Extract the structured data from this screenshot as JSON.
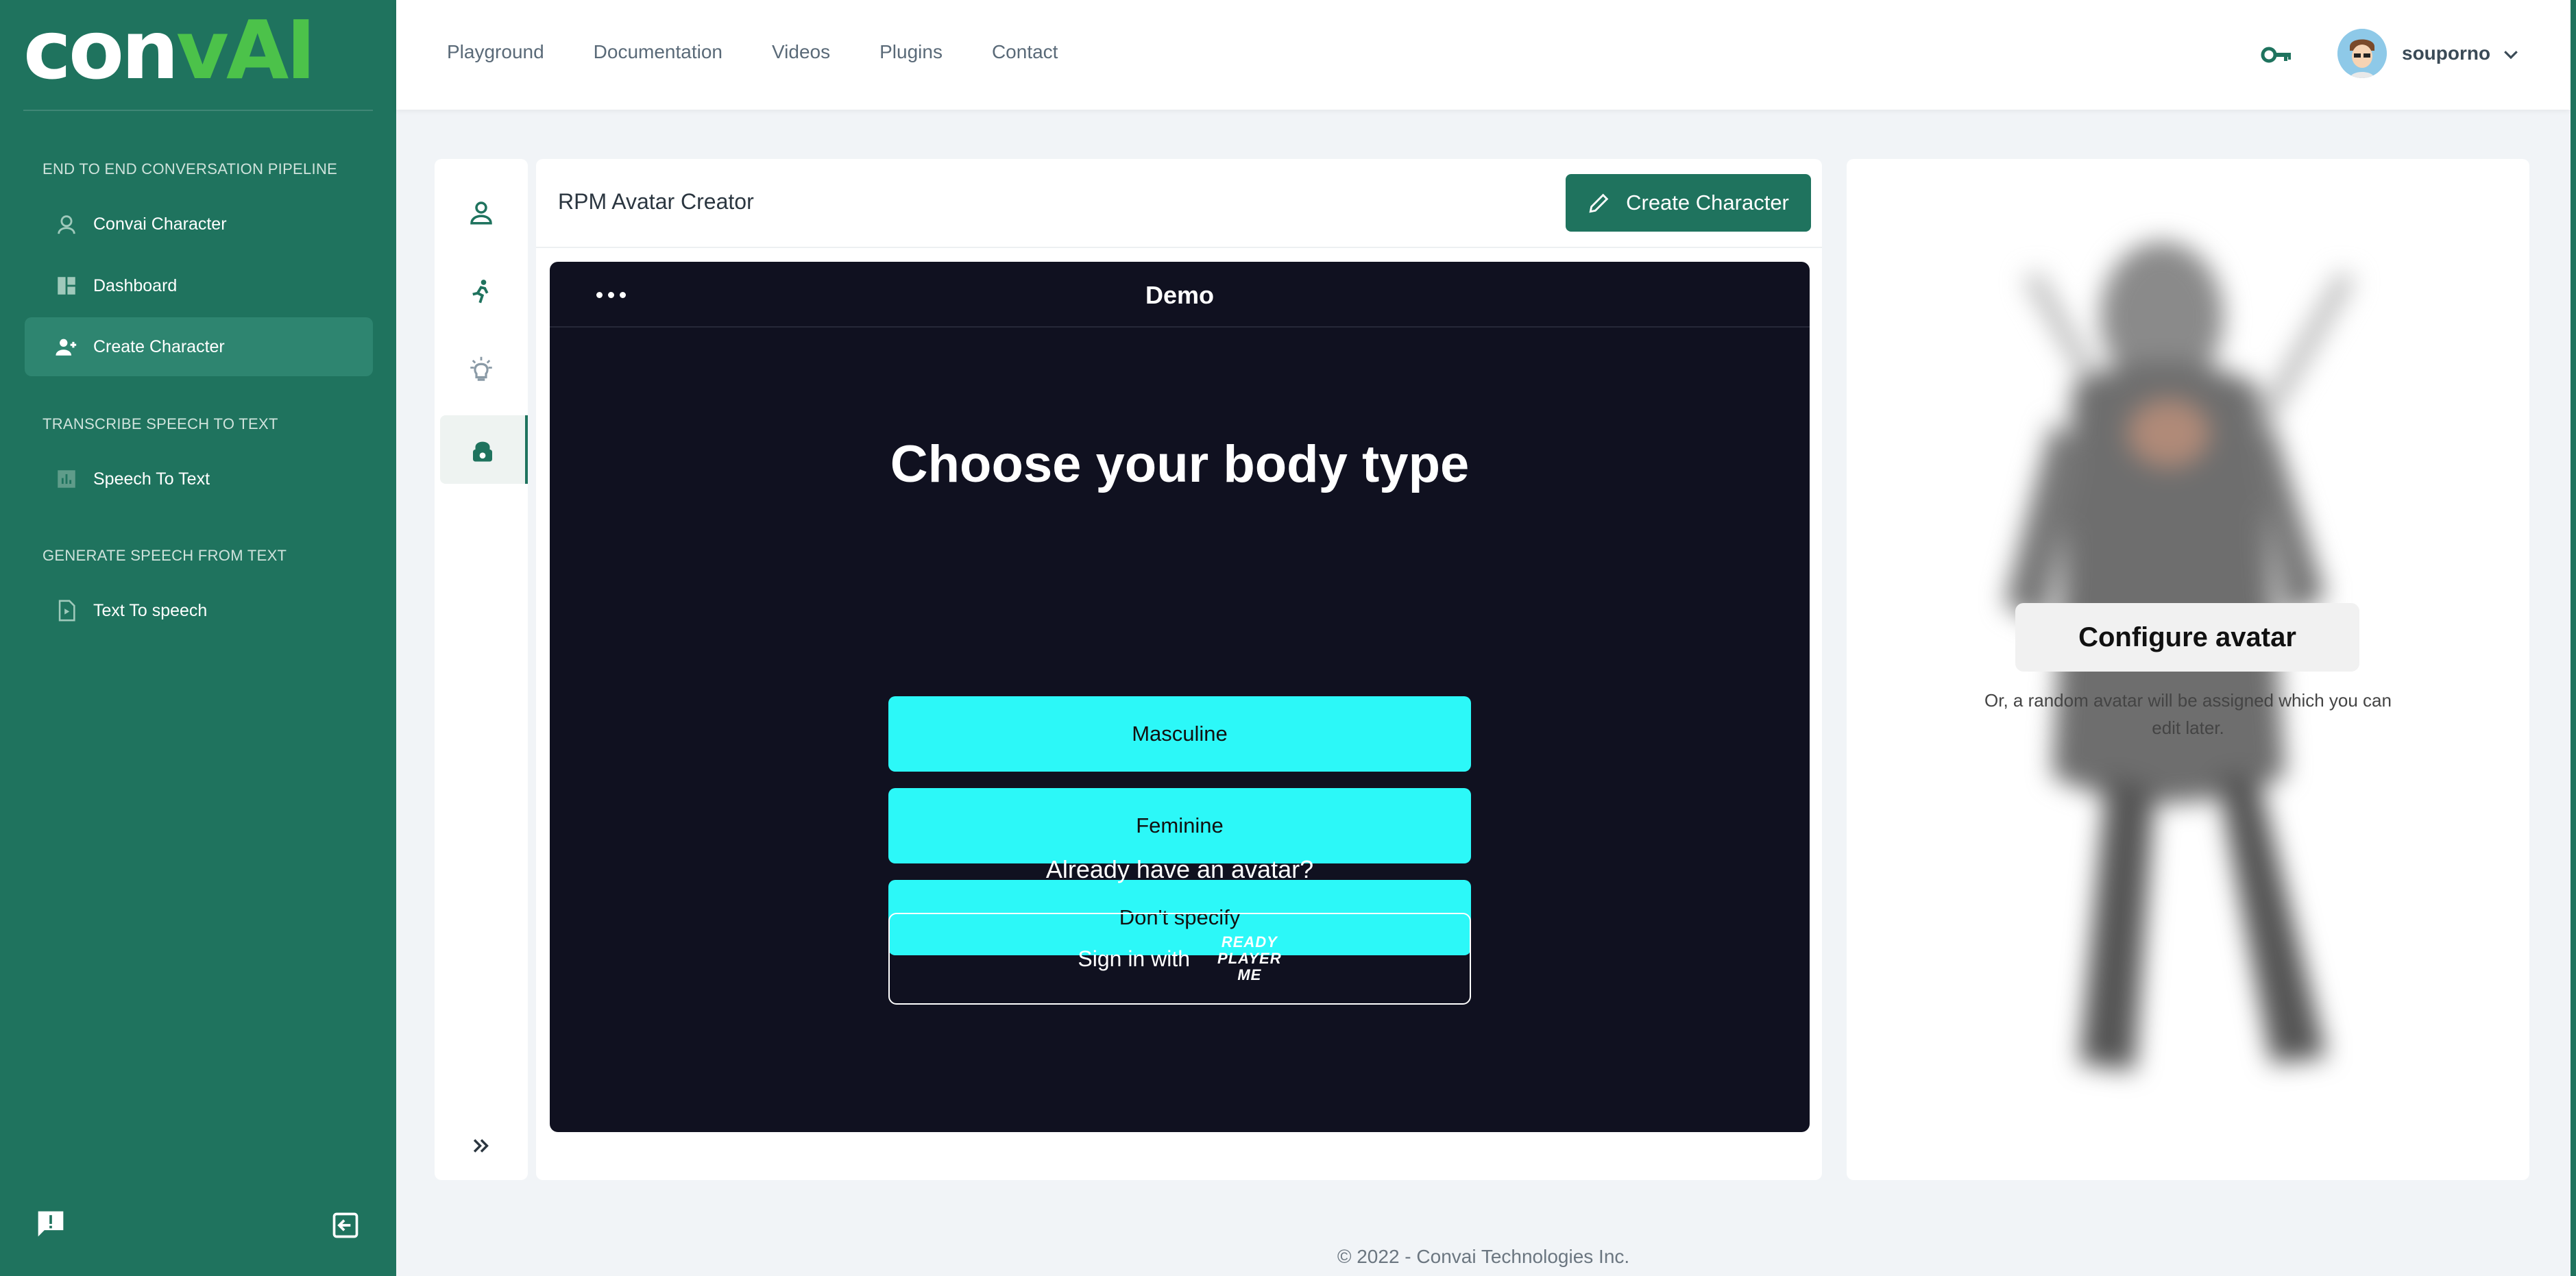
{
  "brand": {
    "logo_main": "con",
    "logo_accent": "vAI"
  },
  "sidebar": {
    "sections": [
      {
        "title": "END TO END CONVERSATION PIPELINE"
      },
      {
        "title": "TRANSCRIBE SPEECH TO TEXT"
      },
      {
        "title": "GENERATE SPEECH FROM TEXT"
      }
    ],
    "items": [
      {
        "label": "Convai Character",
        "icon": "character-icon"
      },
      {
        "label": "Dashboard",
        "icon": "dashboard-icon"
      },
      {
        "label": "Create Character",
        "icon": "add-user-icon",
        "active": true
      },
      {
        "label": "Speech To Text",
        "icon": "chart-icon"
      },
      {
        "label": "Text To speech",
        "icon": "file-play-icon"
      }
    ]
  },
  "header": {
    "nav": [
      "Playground",
      "Documentation",
      "Videos",
      "Plugins",
      "Contact"
    ],
    "username": "souporno"
  },
  "main": {
    "title": "RPM Avatar Creator",
    "create_button": "Create Character",
    "frame": {
      "title": "Demo",
      "heading": "Choose your body type",
      "options": [
        "Masculine",
        "Feminine",
        "Don't specify"
      ],
      "already": "Already have an avatar?",
      "signin": "Sign in with",
      "rpm_logo": [
        "READY",
        "PLAYER",
        "ME"
      ]
    }
  },
  "right_panel": {
    "configure_button": "Configure avatar",
    "note": "Or, a random avatar will be assigned which you can edit later."
  },
  "footer": "© 2022 - Convai Technologies Inc.",
  "colors": {
    "primary": "#1f735e",
    "accent": "#2cf8f8",
    "frame_bg": "#101120"
  }
}
